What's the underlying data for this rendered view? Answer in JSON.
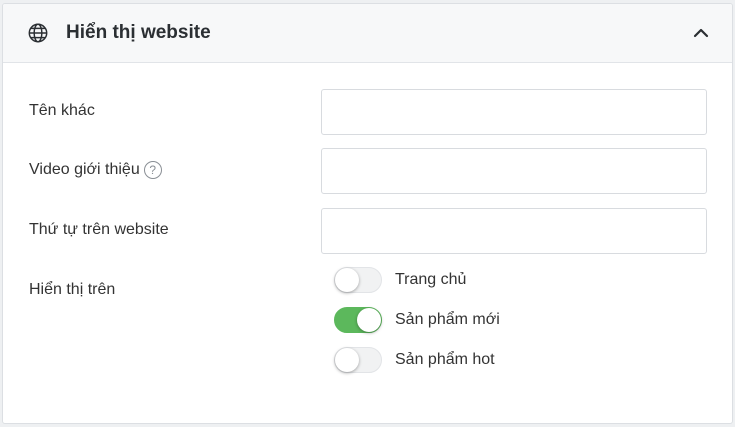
{
  "panel": {
    "title": "Hiển thị website",
    "header_icon": "globe-icon",
    "collapse_icon": "chevron-up-icon"
  },
  "fields": {
    "alt_name": {
      "label": "Tên khác",
      "value": ""
    },
    "intro_video": {
      "label": "Video giới thiệu",
      "help_icon": "question-circle-icon",
      "help_glyph": "?",
      "value": ""
    },
    "website_order": {
      "label": "Thứ tự trên website",
      "value": ""
    }
  },
  "display_on": {
    "label": "Hiển thị trên",
    "options": [
      {
        "label": "Trang chủ",
        "enabled": false
      },
      {
        "label": "Sản phẩm mới",
        "enabled": true
      },
      {
        "label": "Sản phẩm hot",
        "enabled": false
      }
    ]
  },
  "colors": {
    "toggle_on": "#5cb85c",
    "toggle_off": "#f1f2f3",
    "header_bg": "#f7f8f9"
  }
}
